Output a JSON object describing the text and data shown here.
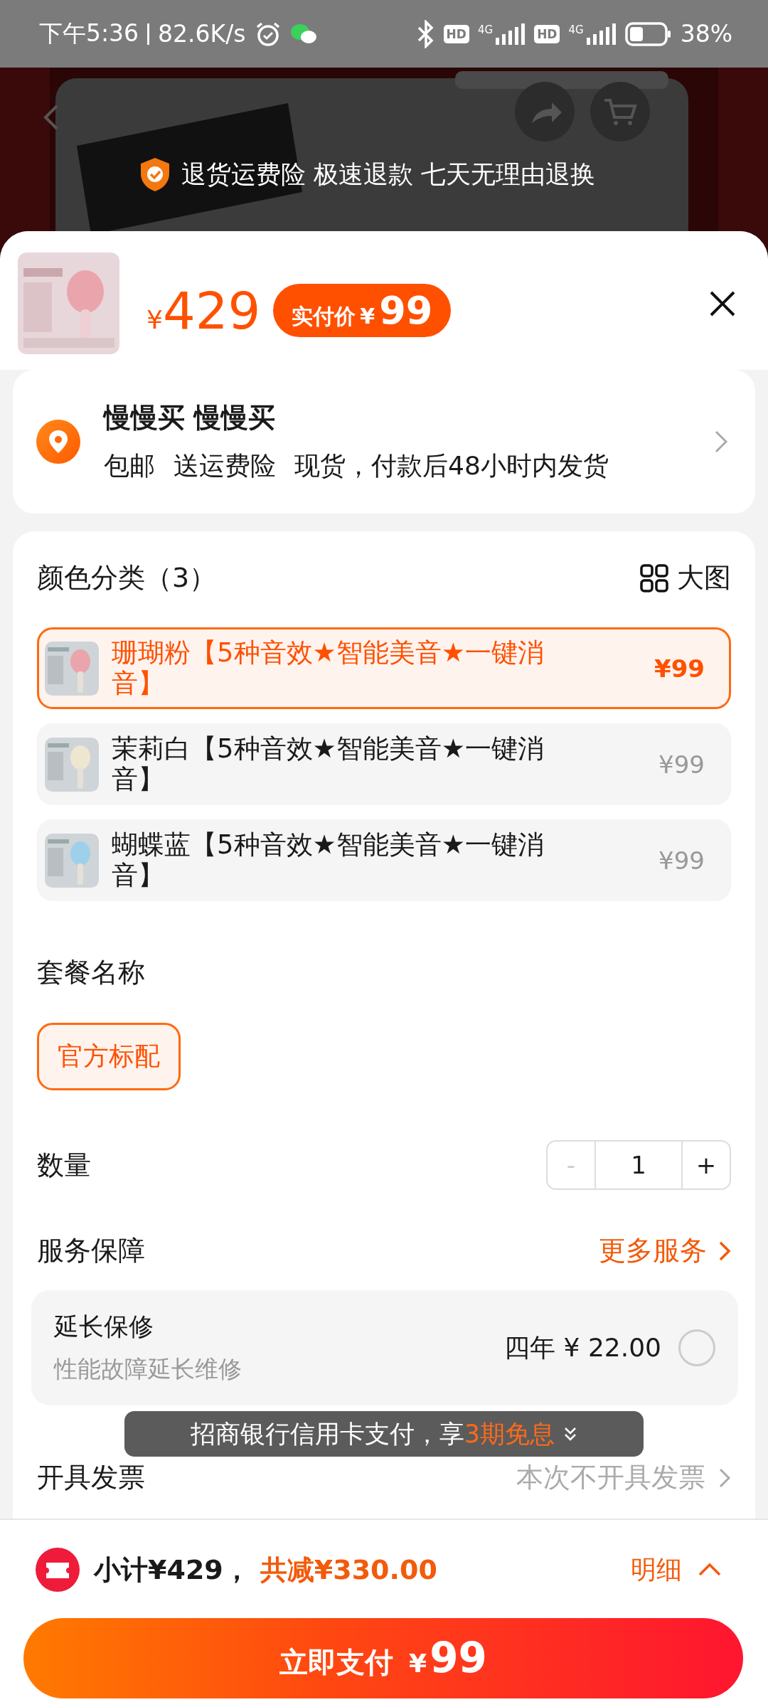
{
  "status_bar": {
    "time": "下午5:36",
    "speed": "82.6K/s",
    "hd_1": "HD",
    "network_1": "4G",
    "hd_2": "HD",
    "network_2": "4G",
    "battery": "38%"
  },
  "trust_banner": {
    "text": "退货运费险 极速退款 七天无理由退换"
  },
  "product": {
    "currency": "¥",
    "price": "429",
    "final_label": "实付价",
    "final_currency": "¥",
    "final_price": "99"
  },
  "address": {
    "name": "慢慢买 慢慢买",
    "details": [
      "包邮",
      "送运费险",
      "现货，付款后48小时内发货"
    ]
  },
  "color_section": {
    "title": "颜色分类（3）",
    "view_toggle": "大图",
    "options": [
      {
        "label": "珊瑚粉【5种音效★智能美音★一键消音】",
        "price": "¥99",
        "selected": true
      },
      {
        "label": "茉莉白【5种音效★智能美音★一键消音】",
        "price": "¥99",
        "selected": false
      },
      {
        "label": "蝴蝶蓝【5种音效★智能美音★一键消音】",
        "price": "¥99",
        "selected": false
      }
    ]
  },
  "package_section": {
    "title": "套餐名称",
    "options": [
      {
        "label": "官方标配",
        "selected": true
      }
    ]
  },
  "quantity": {
    "label": "数量",
    "minus": "-",
    "value": "1",
    "plus": "+",
    "minus_disabled": true
  },
  "service": {
    "title": "服务保障",
    "more": "更多服务",
    "items": [
      {
        "title": "延长保修",
        "subtitle": "性能故障延长维修",
        "price": "四年 ¥ 22.00",
        "checked": false
      }
    ]
  },
  "invoice": {
    "label": "开具发票",
    "value": "本次不开具发票"
  },
  "toast": {
    "text": "招商银行信用卡支付，享",
    "highlight": "3期免息"
  },
  "summary": {
    "subtotal": "小计¥429，",
    "discount": "共减¥330.00",
    "details": "明细"
  },
  "pay_button": {
    "label": "立即支付",
    "currency": "¥",
    "amount": "99"
  }
}
